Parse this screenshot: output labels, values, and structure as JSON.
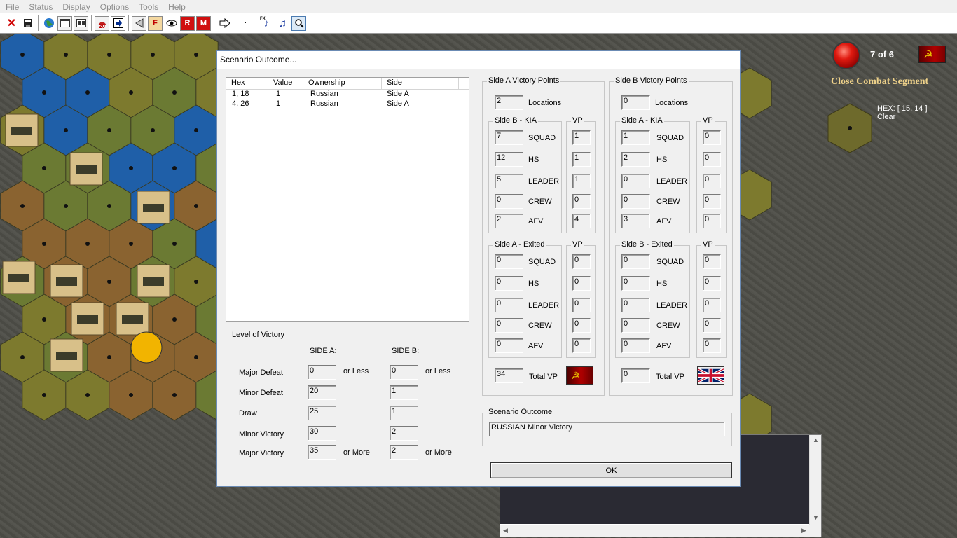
{
  "menu": [
    "File",
    "Status",
    "Display",
    "Options",
    "Tools",
    "Help"
  ],
  "toolbar": {
    "buttons": [
      "close-x",
      "save",
      "globe",
      "window",
      "window2",
      "ambush",
      "next",
      "prev",
      "fire",
      "eye",
      "rout",
      "melee",
      "advance",
      "dot",
      "fx-sound",
      "music",
      "zoom"
    ],
    "f_label": "F",
    "r_label": "R",
    "m_label": "M",
    "ambush_count": "20",
    "fx_label": "FX"
  },
  "hud": {
    "turn": "7 of 6",
    "segment": "Close Combat Segment",
    "hex_label": "HEX: [ 15, 14 ]",
    "terrain": "Clear",
    "faction_symbol": "☭"
  },
  "dialog": {
    "title": "Scenario Outcome...",
    "list": {
      "headers": [
        "Hex",
        "Value",
        "Ownership",
        "Side"
      ],
      "rows": [
        {
          "hex": "1, 18",
          "value": "1",
          "ownership": "Russian",
          "side": "Side A"
        },
        {
          "hex": "4, 26",
          "value": "1",
          "ownership": "Russian",
          "side": "Side A"
        }
      ]
    },
    "level": {
      "title": "Level of Victory",
      "side_a": "SIDE A:",
      "side_b": "SIDE B:",
      "or_less": "or Less",
      "or_more": "or More",
      "rows": [
        {
          "label": "Major Defeat",
          "a": "0",
          "b": "0"
        },
        {
          "label": "Minor Defeat",
          "a": "20",
          "b": "1"
        },
        {
          "label": "Draw",
          "a": "25",
          "b": "1"
        },
        {
          "label": "Minor Victory",
          "a": "30",
          "b": "2"
        },
        {
          "label": "Major Victory",
          "a": "35",
          "b": "2"
        }
      ]
    },
    "side_a": {
      "title": "Side A Victory Points",
      "locations": "2",
      "locations_label": "Locations",
      "kia_title": "Side B - KIA",
      "exited_title": "Side A - Exited",
      "vp_title": "VP",
      "kia": [
        {
          "label": "SQUAD",
          "count": "7",
          "vp": "1"
        },
        {
          "label": "HS",
          "count": "12",
          "vp": "1"
        },
        {
          "label": "LEADER",
          "count": "5",
          "vp": "1"
        },
        {
          "label": "CREW",
          "count": "0",
          "vp": "0"
        },
        {
          "label": "AFV",
          "count": "2",
          "vp": "4"
        }
      ],
      "exited": [
        {
          "label": "SQUAD",
          "count": "0",
          "vp": "0"
        },
        {
          "label": "HS",
          "count": "0",
          "vp": "0"
        },
        {
          "label": "LEADER",
          "count": "0",
          "vp": "0"
        },
        {
          "label": "CREW",
          "count": "0",
          "vp": "0"
        },
        {
          "label": "AFV",
          "count": "0",
          "vp": "0"
        }
      ],
      "total": "34",
      "total_label": "Total VP",
      "flag_symbol": "☭"
    },
    "side_b": {
      "title": "Side B Victory Points",
      "locations": "0",
      "locations_label": "Locations",
      "kia_title": "Side A - KIA",
      "exited_title": "Side B - Exited",
      "vp_title": "VP",
      "kia": [
        {
          "label": "SQUAD",
          "count": "1",
          "vp": "0"
        },
        {
          "label": "HS",
          "count": "2",
          "vp": "0"
        },
        {
          "label": "LEADER",
          "count": "0",
          "vp": "0"
        },
        {
          "label": "CREW",
          "count": "0",
          "vp": "0"
        },
        {
          "label": "AFV",
          "count": "3",
          "vp": "0"
        }
      ],
      "exited": [
        {
          "label": "SQUAD",
          "count": "0",
          "vp": "0"
        },
        {
          "label": "HS",
          "count": "0",
          "vp": "0"
        },
        {
          "label": "LEADER",
          "count": "0",
          "vp": "0"
        },
        {
          "label": "CREW",
          "count": "0",
          "vp": "0"
        },
        {
          "label": "AFV",
          "count": "0",
          "vp": "0"
        }
      ],
      "total": "0",
      "total_label": "Total VP"
    },
    "outcome": {
      "title": "Scenario Outcome",
      "value": "RUSSIAN Minor Victory"
    },
    "ok_label": "OK"
  },
  "colors": {
    "water": "#1f5fa8",
    "grass": "#7d7a2e",
    "brush": "#6b7a33",
    "dirt": "#8a6330",
    "accent": "#efd28a"
  }
}
